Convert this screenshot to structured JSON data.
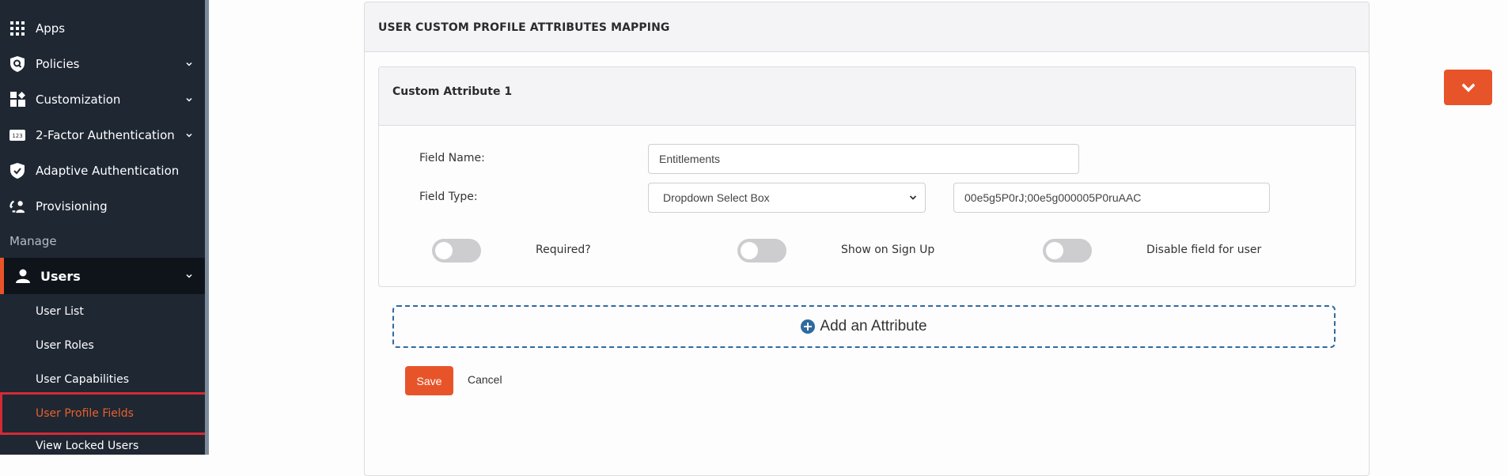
{
  "sidebar": {
    "items": [
      {
        "label": "Apps",
        "icon": "grid-icon",
        "has_chevron": false
      },
      {
        "label": "Policies",
        "icon": "shield-search-icon",
        "has_chevron": true
      },
      {
        "label": "Customization",
        "icon": "widgets-icon",
        "has_chevron": true
      },
      {
        "label": "2-Factor Authentication",
        "icon": "numeric-123-icon",
        "has_chevron": true
      },
      {
        "label": "Adaptive Authentication",
        "icon": "shield-check-icon",
        "has_chevron": false
      },
      {
        "label": "Provisioning",
        "icon": "user-sync-icon",
        "has_chevron": false
      }
    ],
    "section_label": "Manage",
    "users": {
      "label": "Users",
      "icon": "user-icon",
      "expanded": true
    },
    "sub_items": [
      {
        "label": "User List"
      },
      {
        "label": "User Roles"
      },
      {
        "label": "User Capabilities"
      },
      {
        "label": "User Profile Fields",
        "active": true
      },
      {
        "label": "View Locked Users"
      }
    ]
  },
  "panel": {
    "title": "USER CUSTOM PROFILE ATTRIBUTES MAPPING",
    "attribute": {
      "title": "Custom Attribute 1",
      "field_name_label": "Field Name:",
      "field_name_value": "Entitlements",
      "field_type_label": "Field Type:",
      "field_type_value": "Dropdown Select Box",
      "options_value": "00e5g5P0rJ;00e5g000005P0ruAAC",
      "toggles": [
        {
          "label": "Required?",
          "on": false
        },
        {
          "label": "Show on Sign Up",
          "on": false
        },
        {
          "label": "Disable field for user",
          "on": false
        }
      ]
    },
    "add_attribute_label": "Add an Attribute",
    "save_label": "Save",
    "cancel_label": "Cancel"
  },
  "colors": {
    "accent": "#e8542a",
    "sidebar_bg": "#1f2733",
    "active_highlight": "#d42a35",
    "link_blue": "#2f6a9e"
  }
}
